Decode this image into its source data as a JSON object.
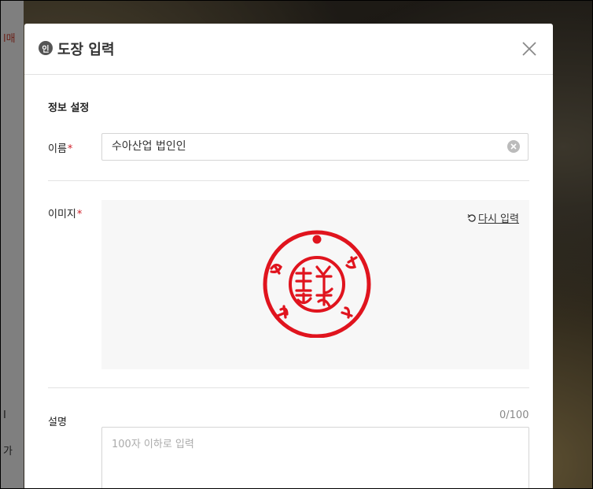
{
  "background": {
    "fragments": [
      "l매",
      "Ⅰ",
      "가"
    ]
  },
  "modal": {
    "title_icon": "인",
    "title": "도장 입력",
    "close_icon": "close-icon"
  },
  "form": {
    "section_title": "정보 설정",
    "name_label": "이름",
    "image_label": "이미지",
    "required_mark": "*",
    "name_value": "수아산업 법인인",
    "redo_label": "다시 입력",
    "description_label": "설명",
    "description_counter": "0/100",
    "description_placeholder": "100자 이하로 입력"
  },
  "colors": {
    "required": "#d0202a",
    "stamp": "#e0141e"
  }
}
